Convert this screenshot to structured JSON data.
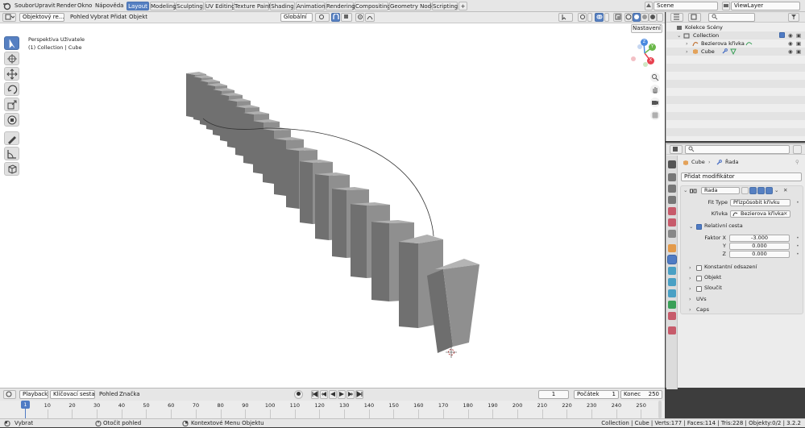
{
  "topbar": {
    "menus": [
      "Soubor",
      "Upravit",
      "Render",
      "Okno",
      "Nápověda"
    ],
    "workspaces": [
      "Layout",
      "Modeling",
      "Sculpting",
      "UV Editing",
      "Texture Paint",
      "Shading",
      "Animation",
      "Rendering",
      "Compositing",
      "Geometry Nodes",
      "Scripting"
    ],
    "active_workspace": "Layout",
    "add_workspace": "+",
    "scene": "Scene",
    "view_layer": "ViewLayer"
  },
  "viewport_header": {
    "mode": "Objektový re...",
    "menus": [
      "Pohled",
      "Vybrat",
      "Přidat",
      "Objekt"
    ],
    "transform_orientation": "Globální",
    "options": "Nastavení"
  },
  "viewport": {
    "view_name": "Perspektiva Uživatele",
    "context_line": "(1) Collection | Cube",
    "gizmo_axes": {
      "x": "X",
      "y": "Y",
      "z": "Z"
    }
  },
  "outliner": {
    "root": "Kolekce Scény",
    "items": [
      {
        "label": "Collection",
        "type": "collection"
      },
      {
        "label": "Bezierova křivka",
        "type": "curve"
      },
      {
        "label": "Cube",
        "type": "mesh"
      }
    ]
  },
  "properties": {
    "breadcrumb_object": "Cube",
    "breadcrumb_modifier": "Řada",
    "add_modifier": "Přidat modifikátor",
    "modifier_name": "Řada",
    "fit_type_label": "Fit Type",
    "fit_type_value": "Přizpůsobit křivku",
    "curve_label": "Křivka",
    "curve_value": "Bezierova křivka",
    "relative_offset_label": "Relativní cesta",
    "factor_x_label": "Faktor X",
    "factor_x": "-3.000",
    "factor_y_label": "Y",
    "factor_y": "0.000",
    "factor_z_label": "Z",
    "factor_z": "0.000",
    "constant_offset": "Konstantní odsazení",
    "object_offset": "Objekt",
    "merge": "Sloučit",
    "uvs": "UVs",
    "caps": "Caps"
  },
  "timeline": {
    "playback": "Playback",
    "keying": "Klíčovací sestava",
    "view": "Pohled",
    "marker": "Značka",
    "current_frame": "1",
    "start_label": "Počátek",
    "start": "1",
    "end_label": "Konec",
    "end": "250",
    "ticks": [
      "1",
      "10",
      "20",
      "30",
      "40",
      "50",
      "60",
      "70",
      "80",
      "90",
      "100",
      "110",
      "120",
      "130",
      "140",
      "150",
      "160",
      "170",
      "180",
      "190",
      "200",
      "210",
      "220",
      "230",
      "240",
      "250"
    ]
  },
  "statusbar": {
    "select": "Vybrat",
    "rotate": "Otočit pohled",
    "context_menu": "Kontextové Menu Objektu",
    "stats": "Collection | Cube | Verts:177 | Faces:114 | Tris:228 | Objekty:0/2 | 3.2.2"
  },
  "colors": {
    "accent": "#5680c2",
    "active_frame": "#4f7bc4",
    "gizmo_x": "#e8414f",
    "gizmo_y": "#6bb84a",
    "gizmo_z": "#4a8ae0",
    "cube_front": "#8f8f8f",
    "cube_side": "#6e6e6e",
    "cube_top": "#a8a8a8"
  }
}
